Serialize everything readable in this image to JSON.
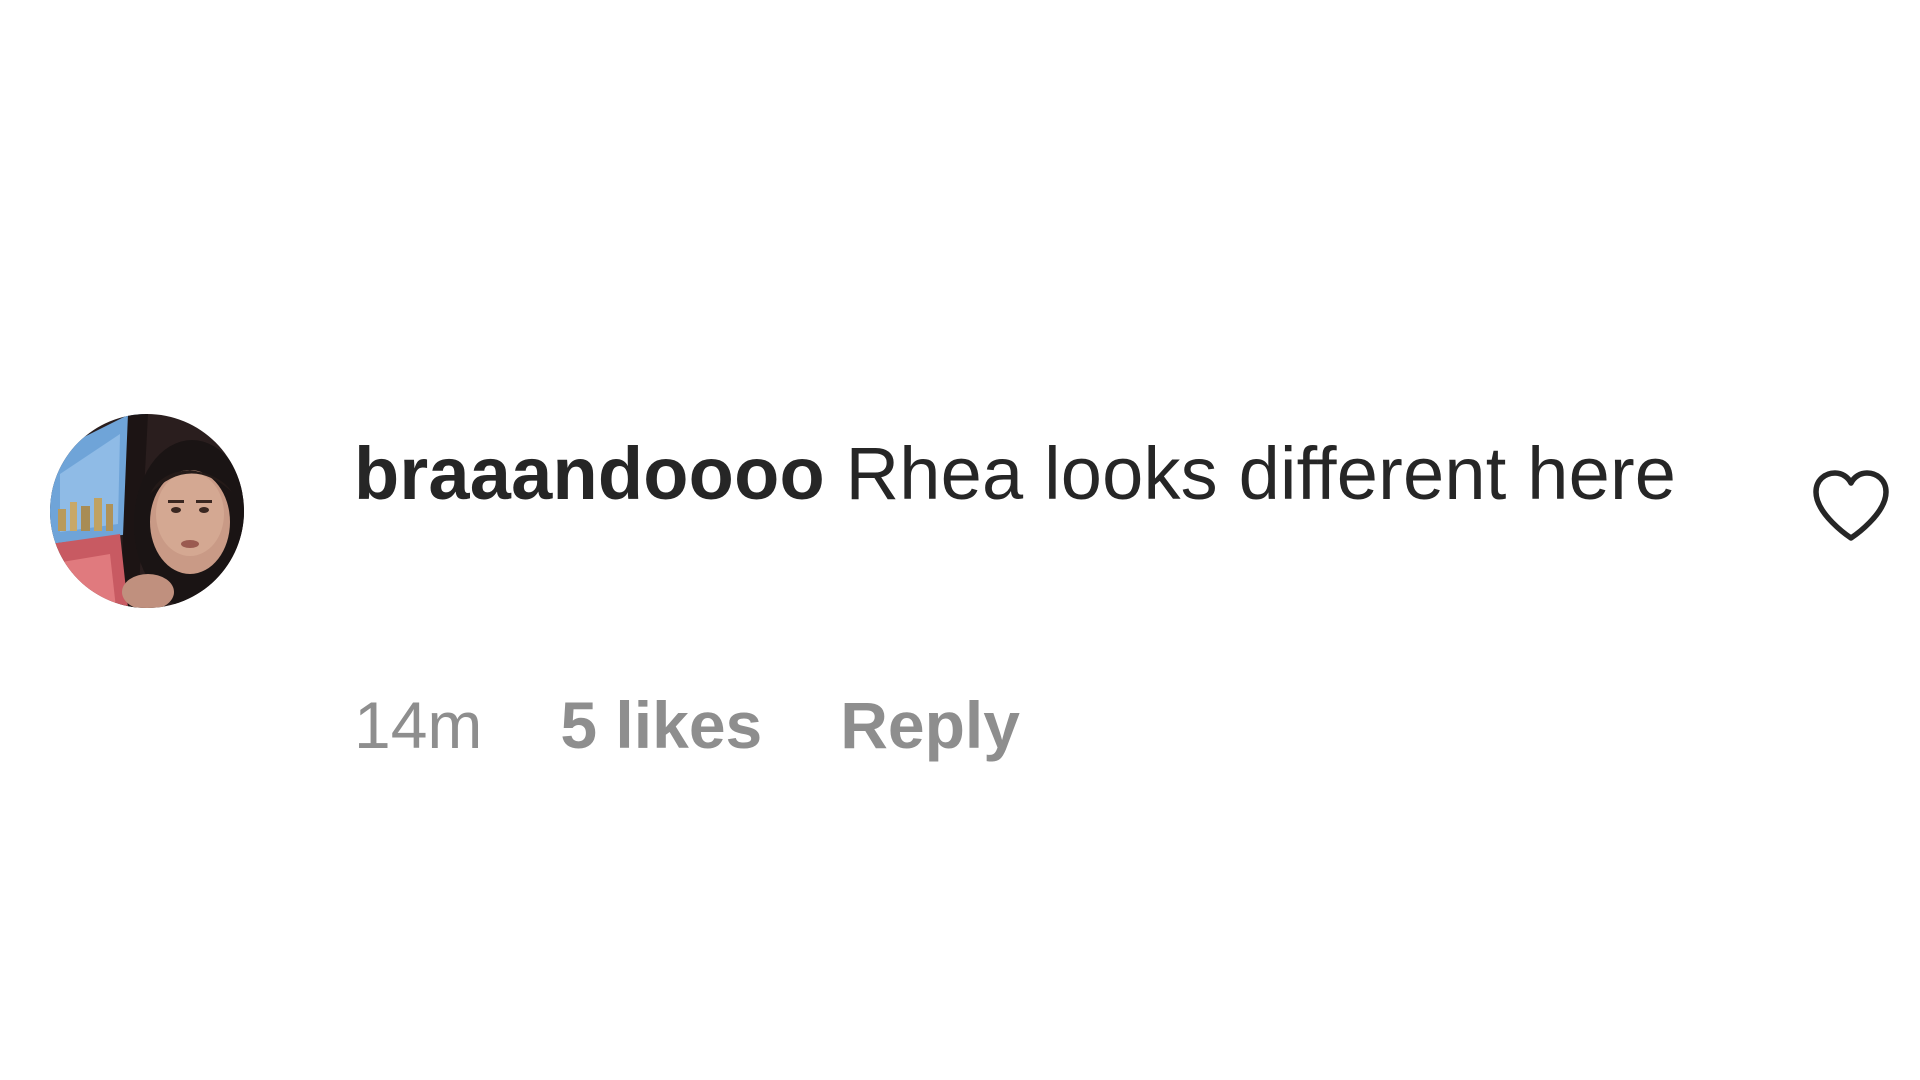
{
  "comment": {
    "username": "braaandoooo",
    "text": "Rhea looks different here",
    "timestamp": "14m",
    "likes": "5 likes",
    "reply_label": "Reply"
  },
  "icons": {
    "like": "heart-outline-icon",
    "avatar": "user-avatar"
  },
  "colors": {
    "text": "#262626",
    "meta": "#8e8e8e",
    "background": "#ffffff"
  }
}
